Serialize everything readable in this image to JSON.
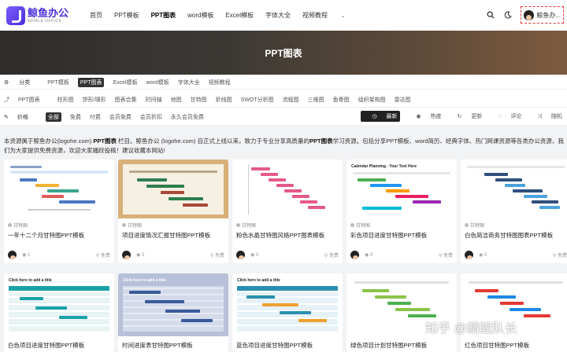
{
  "header": {
    "logo_cn": "鲸鱼办公",
    "logo_en": "WHALE OFFICE",
    "nav": [
      {
        "label": "首页",
        "active": false
      },
      {
        "label": "PPT模板",
        "active": false
      },
      {
        "label": "PPT图表",
        "active": true
      },
      {
        "label": "word模板",
        "active": false
      },
      {
        "label": "Excel模板",
        "active": false
      },
      {
        "label": "字体大全",
        "active": false
      },
      {
        "label": "视频教程",
        "active": false
      }
    ],
    "user_name": "鲸鱼办..."
  },
  "banner": {
    "title": "PPT图表"
  },
  "filters": {
    "category_label": "分类",
    "categories": [
      "PPT模板",
      "PPT图表",
      "Excel模板",
      "word模板",
      "字体大全",
      "视频教程"
    ],
    "category_active": "PPT图表",
    "subcategories": [
      "PPT图表",
      "柱形图",
      "饼形/環形",
      "图表合集",
      "时间轴",
      "地图",
      "甘特图",
      "折线图",
      "SWOT分析图",
      "流程图",
      "三维图",
      "鱼骨图",
      "组织架构图",
      "雷达图"
    ],
    "price_label": "价格",
    "prices": [
      "全部",
      "免费",
      "付费",
      "会员免费",
      "会员折扣",
      "永久会员免费"
    ],
    "price_active": "全部",
    "sort": [
      "最新",
      "热度",
      "更新",
      "评论",
      "随机"
    ]
  },
  "description": {
    "part1": "本资源属于鲸鱼办公(logohe.com) ",
    "bold1": "PPT图表",
    "part2": " 栏目。鲸鱼办公 (logohe.com) 自正式上线以来，致力于专业分享高质量的",
    "bold2": "PPT图表",
    "part3": "学习资源。包括分享PPT模板、word简历、经典字体、热门网课资源等各类办公资源，我们为大家提供免费资源，欢迎大家踊跃投稿！建议收藏本网站!"
  },
  "cards": [
    {
      "category": "甘特图",
      "title": "一年十二个月甘特图PPT模板",
      "views": "1",
      "price": "免费"
    },
    {
      "category": "甘特图",
      "title": "项目进度情况汇报甘特图PPT模板",
      "views": "0",
      "price": "免费"
    },
    {
      "category": "甘特图",
      "title": "粉色水晶甘特图风格PPT图表模板",
      "views": "0",
      "price": "免费"
    },
    {
      "category": "甘特图",
      "title": "彩色项目进度甘特图PPT模板",
      "views": "0",
      "price": "免费"
    },
    {
      "category": "甘特图",
      "title": "白色简洁商务甘特图图表PPT模板",
      "views": "0",
      "price": "免费"
    }
  ],
  "cards_row2": [
    {
      "title": "白色项目进度甘特图PPT模板",
      "slide_head": "Click here to add a title"
    },
    {
      "title": "时间进度表甘特图PPT模板",
      "slide_head": "Click here to add a title"
    },
    {
      "title": "蓝色项目进度甘特图PPT模板",
      "slide_head": "Click here to add a title"
    },
    {
      "title": "绿色项目计划甘特图PPT模板",
      "slide_head": ""
    },
    {
      "title": "红色项目甘特图PPT模板",
      "slide_head": ""
    }
  ],
  "card_slide_text": {
    "c4_head": "Calendar   Planning - Your Text Here"
  },
  "watermark": "知乎 @鲭鲵队长",
  "colors": {
    "accent": "#4a2fd9",
    "banner": "#3c3935"
  }
}
